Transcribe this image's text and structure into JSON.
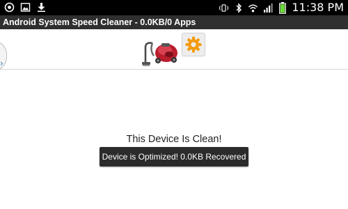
{
  "status_bar": {
    "time": "11:38 PM",
    "left_icons": [
      "alarm-icon",
      "image-icon",
      "download-icon"
    ],
    "right_icons": [
      "vibrate-icon",
      "bluetooth-icon",
      "wifi-icon",
      "signal-icon",
      "battery-icon"
    ],
    "battery_color": "#6ad83a"
  },
  "title_bar": {
    "title": "Android System Speed Cleaner -  0.0KB/0 Apps"
  },
  "toolbar": {
    "clean_icon": "vacuum-cleaner-icon",
    "settings_icon": "gear-icon",
    "drawer_icon": "chevron-right-icon",
    "accent_color": "#f39c12"
  },
  "main": {
    "message": "This Device Is Clean!"
  },
  "toast": {
    "text": "Device is Optimized!  0.0KB Recovered"
  }
}
